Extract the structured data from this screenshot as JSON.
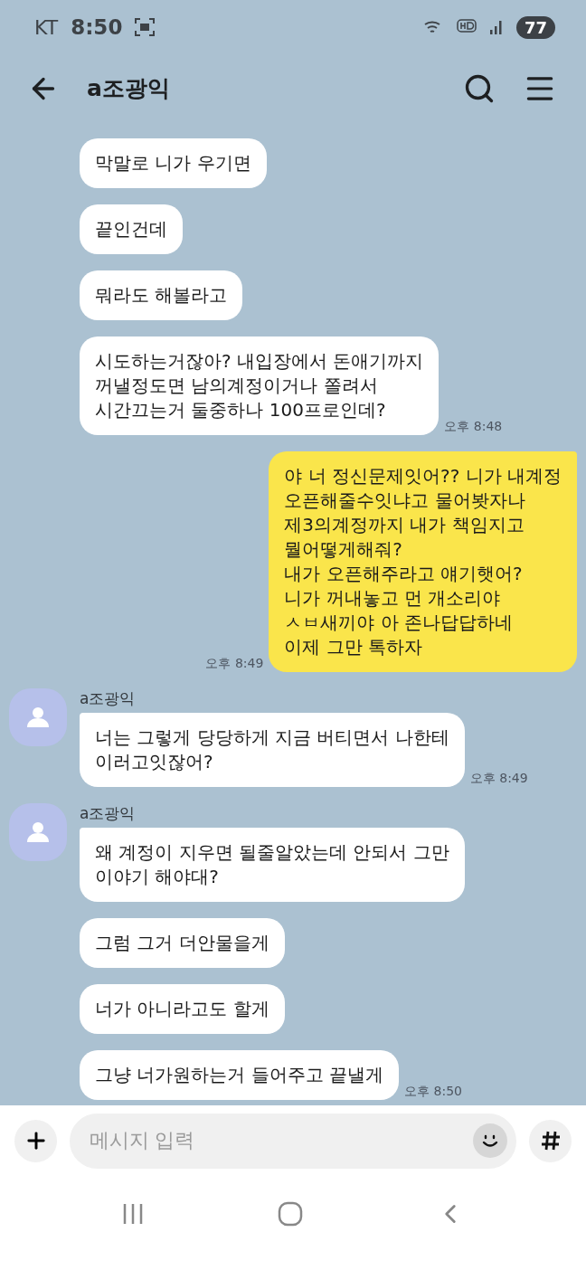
{
  "status_bar": {
    "carrier": "KT",
    "time": "8:50",
    "battery": "77"
  },
  "header": {
    "title": "a조광익"
  },
  "messages": [
    {
      "kind": "received",
      "text": "막말로 니가 우기면"
    },
    {
      "kind": "received",
      "text": "끝인건데"
    },
    {
      "kind": "received",
      "text": "뭐라도 해볼라고"
    },
    {
      "kind": "received",
      "text": "시도하는거잖아? 내입장에서 돈애기까지\n꺼낼정도면 남의계정이거나 쫄려서\n시간끄는거 둘중하나 100프로인데?",
      "time": "오후 8:48"
    },
    {
      "kind": "sent",
      "text": "야 너 정신문제잇어?? 니가 내계정\n오픈해줄수잇냐고 물어봣자나\n제3의계정까지 내가 책임지고\n뭘어떻게해줘?\n내가 오픈해주라고 얘기햇어?\n니가 꺼내놓고 먼 개소리야\nㅅㅂ새끼야 아 존나답답하네\n이제 그만 톡하자",
      "time": "오후 8:49"
    },
    {
      "kind": "received",
      "sender": "a조광익",
      "text": "너는 그렇게 당당하게 지금 버티면서 나한테\n이러고잇잖어?",
      "time": "오후 8:49"
    },
    {
      "kind": "received",
      "sender": "a조광익",
      "text": "왜 계정이 지우면 될줄알았는데 안되서 그만\n이야기 해야대?"
    },
    {
      "kind": "received",
      "text": "그럼 그거 더안물을게"
    },
    {
      "kind": "received",
      "text": "너가 아니라고도 할게"
    },
    {
      "kind": "received",
      "text": "그냥 너가원하는거 들어주고 끝낼게",
      "time": "오후 8:50"
    }
  ],
  "input": {
    "placeholder": "메시지 입력"
  }
}
